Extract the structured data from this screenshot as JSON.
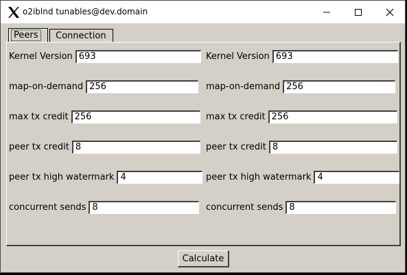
{
  "window": {
    "title": "o2iblnd tunables@dev.domain"
  },
  "tabs": [
    {
      "label": "Peers",
      "active": true
    },
    {
      "label": "Connection",
      "active": false
    }
  ],
  "left_fields": [
    {
      "label": "Kernel Version",
      "value": "693"
    },
    {
      "label": "map-on-demand",
      "value": "256"
    },
    {
      "label": "max tx credit",
      "value": "256"
    },
    {
      "label": "peer tx credit",
      "value": "8"
    },
    {
      "label": "peer tx high watermark",
      "value": "4"
    },
    {
      "label": "concurrent sends",
      "value": "8"
    }
  ],
  "right_fields": [
    {
      "label": "Kernel Version",
      "value": "693"
    },
    {
      "label": "map-on-demand",
      "value": "256"
    },
    {
      "label": "max tx credit",
      "value": "256"
    },
    {
      "label": "peer tx credit",
      "value": "8"
    },
    {
      "label": "peer tx high watermark",
      "value": "4"
    },
    {
      "label": "concurrent sends",
      "value": "8"
    }
  ],
  "actions": {
    "calculate_label": "Calculate"
  },
  "icons": {
    "app": "x-logo-icon",
    "minimize": "minimize-icon",
    "maximize": "maximize-icon",
    "close": "close-icon"
  }
}
